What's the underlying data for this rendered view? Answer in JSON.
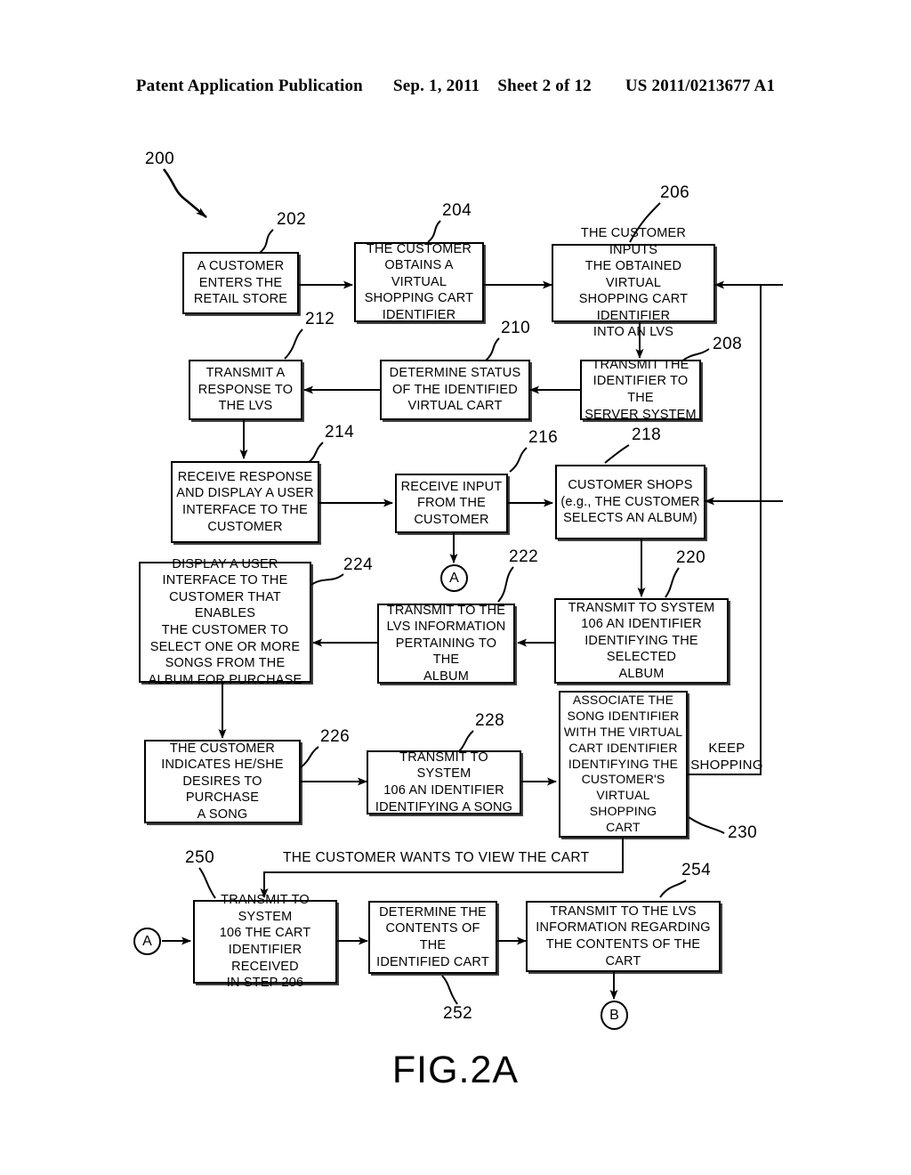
{
  "header": {
    "publication": "Patent Application Publication",
    "date": "Sep. 1, 2011",
    "sheet": "Sheet 2 of 12",
    "docnum": "US 2011/0213677 A1"
  },
  "figure": {
    "caption": "FIG.2A",
    "diagram_numeral": "200"
  },
  "boxes": {
    "b202": "A CUSTOMER ENTERS THE RETAIL STORE",
    "b204": "THE CUSTOMER OBTAINS A VIRTUAL SHOPPING CART IDENTIFIER",
    "b206": "THE CUSTOMER INPUTS THE OBTAINED VIRTUAL SHOPPING CART IDENTIFIER INTO AN LVS",
    "b208": "TRANSMIT THE IDENTIFIER TO THE SERVER SYSTEM",
    "b210": "DETERMINE STATUS OF THE IDENTIFIED VIRTUAL CART",
    "b212": "TRANSMIT A RESPONSE TO THE LVS",
    "b214": "RECEIVE RESPONSE AND DISPLAY A USER INTERFACE TO THE CUSTOMER",
    "b216": "RECEIVE INPUT FROM THE CUSTOMER",
    "b218": "CUSTOMER SHOPS (e.g., THE CUSTOMER SELECTS AN ALBUM)",
    "b220": "TRANSMIT TO SYSTEM 106 AN IDENTIFIER IDENTIFYING THE SELECTED ALBUM",
    "b222": "TRANSMIT TO THE LVS INFORMATION PERTAINING TO THE ALBUM",
    "b224": "DISPLAY A USER INTERFACE TO THE CUSTOMER THAT ENABLES THE CUSTOMER TO SELECT ONE OR MORE SONGS FROM THE ALBUM FOR PURCHASE",
    "b226": "THE CUSTOMER INDICATES HE/SHE DESIRES TO PURCHASE A SONG",
    "b228": "TRANSMIT TO SYSTEM 106 AN IDENTIFIER IDENTIFYING A SONG",
    "b230": "ASSOCIATE THE SONG IDENTIFIER WITH THE VIRTUAL CART IDENTIFIER IDENTIFYING THE CUSTOMER'S VIRTUAL SHOPPING CART",
    "b250": "TRANSMIT TO SYSTEM 106 THE CART IDENTIFIER RECEIVED IN STEP 206",
    "b252": "DETERMINE THE CONTENTS OF THE IDENTIFIED CART",
    "b254": "TRANSMIT TO THE LVS INFORMATION REGARDING THE CONTENTS OF THE CART"
  },
  "box_lines": {
    "b202": [
      "A CUSTOMER",
      "ENTERS THE",
      "RETAIL STORE"
    ],
    "b204": [
      "THE CUSTOMER",
      "OBTAINS A VIRTUAL",
      "SHOPPING CART",
      "IDENTIFIER"
    ],
    "b206": [
      "THE CUSTOMER INPUTS",
      "THE OBTAINED VIRTUAL",
      "SHOPPING CART IDENTIFIER",
      "INTO AN LVS"
    ],
    "b208": [
      "TRANSMIT THE",
      "IDENTIFIER TO THE",
      "SERVER SYSTEM"
    ],
    "b210": [
      "DETERMINE STATUS",
      "OF THE IDENTIFIED",
      "VIRTUAL CART"
    ],
    "b212": [
      "TRANSMIT A",
      "RESPONSE TO",
      "THE LVS"
    ],
    "b214": [
      "RECEIVE RESPONSE",
      "AND DISPLAY A USER",
      "INTERFACE TO THE",
      "CUSTOMER"
    ],
    "b216": [
      "RECEIVE INPUT",
      "FROM THE",
      "CUSTOMER"
    ],
    "b218": [
      "CUSTOMER SHOPS",
      "(e.g., THE CUSTOMER",
      "SELECTS AN ALBUM)"
    ],
    "b220": [
      "TRANSMIT TO SYSTEM",
      "106 AN IDENTIFIER",
      "IDENTIFYING THE SELECTED",
      "ALBUM"
    ],
    "b222": [
      "TRANSMIT TO THE",
      "LVS INFORMATION",
      "PERTAINING TO THE",
      "ALBUM"
    ],
    "b224": [
      "DISPLAY A USER",
      "INTERFACE TO THE",
      "CUSTOMER THAT ENABLES",
      "THE CUSTOMER TO",
      "SELECT ONE OR MORE",
      "SONGS FROM THE",
      "ALBUM FOR PURCHASE"
    ],
    "b226": [
      "THE CUSTOMER",
      "INDICATES HE/SHE",
      "DESIRES TO PURCHASE",
      "A SONG"
    ],
    "b228": [
      "TRANSMIT TO SYSTEM",
      "106 AN IDENTIFIER",
      "IDENTIFYING A SONG"
    ],
    "b230": [
      "ASSOCIATE THE",
      "SONG IDENTIFIER",
      "WITH THE VIRTUAL",
      "CART IDENTIFIER",
      "IDENTIFYING THE",
      "CUSTOMER'S",
      "VIRTUAL SHOPPING",
      "CART"
    ],
    "b250": [
      "TRANSMIT TO SYSTEM",
      "106 THE CART",
      "IDENTIFIER RECEIVED",
      "IN STEP 206"
    ],
    "b252": [
      "DETERMINE THE",
      "CONTENTS OF THE",
      "IDENTIFIED CART"
    ],
    "b254": [
      "TRANSMIT TO THE LVS",
      "INFORMATION REGARDING",
      "THE CONTENTS OF THE CART"
    ]
  },
  "numerals": {
    "n200": "200",
    "n202": "202",
    "n204": "204",
    "n206": "206",
    "n208": "208",
    "n210": "210",
    "n212": "212",
    "n214": "214",
    "n216": "216",
    "n218": "218",
    "n220": "220",
    "n222": "222",
    "n224": "224",
    "n226": "226",
    "n228": "228",
    "n230": "230",
    "n250": "250",
    "n252": "252",
    "n254": "254"
  },
  "labels": {
    "keep_shopping_l1": "KEEP",
    "keep_shopping_l2": "SHOPPING",
    "view_cart": "THE CUSTOMER WANTS TO VIEW THE CART"
  },
  "connectors": {
    "a1": "A",
    "a2": "A",
    "b1": "B"
  },
  "colors": {
    "ink": "#000000",
    "paper": "#ffffff"
  }
}
